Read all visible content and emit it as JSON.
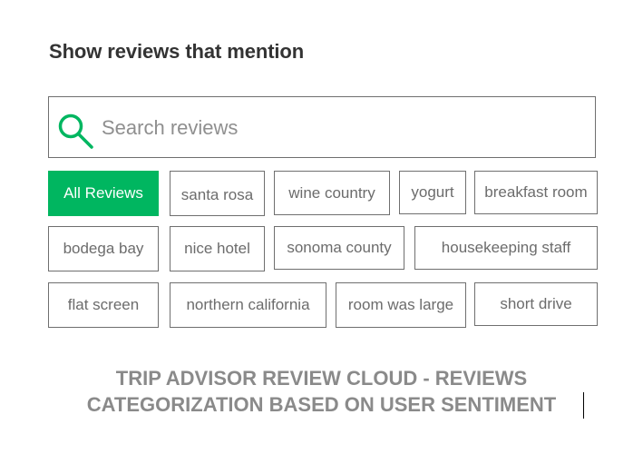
{
  "header": {
    "title": "Show reviews that mention"
  },
  "search": {
    "placeholder": "Search reviews",
    "value": "",
    "icon": "search-icon",
    "icon_color": "#00b660"
  },
  "filters": {
    "active_color": "#00b660",
    "rows": [
      [
        {
          "label": "All Reviews",
          "active": true
        },
        {
          "label": "santa rosa",
          "active": false
        },
        {
          "label": "wine country",
          "active": false
        },
        {
          "label": "yogurt",
          "active": false
        },
        {
          "label": "breakfast room",
          "active": false
        }
      ],
      [
        {
          "label": "bodega bay",
          "active": false
        },
        {
          "label": "nice hotel",
          "active": false
        },
        {
          "label": "sonoma county",
          "active": false
        },
        {
          "label": "housekeeping staff",
          "active": false
        }
      ],
      [
        {
          "label": "flat screen",
          "active": false
        },
        {
          "label": "northern california",
          "active": false
        },
        {
          "label": "room was large",
          "active": false
        },
        {
          "label": "short drive",
          "active": false
        }
      ]
    ]
  },
  "caption": {
    "line1": "TRIP ADVISOR REVIEW CLOUD - REVIEWS",
    "line2": "CATEGORIZATION BASED ON USER SENTIMENT"
  }
}
